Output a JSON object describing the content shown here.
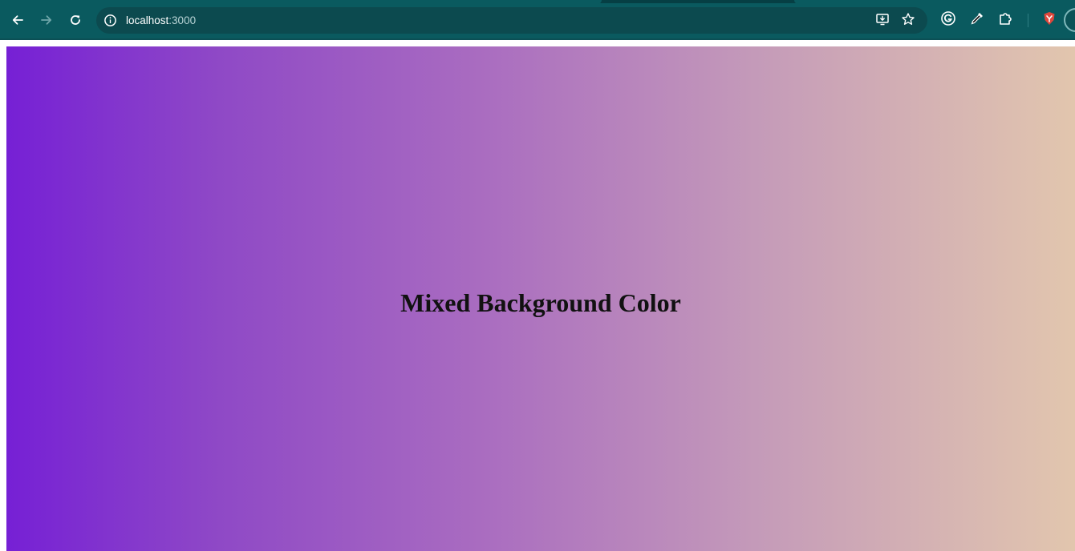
{
  "browser": {
    "address_bar": {
      "host": "localhost",
      "port": ":3000"
    },
    "nav_icons": [
      "back-arrow-icon",
      "forward-arrow-icon",
      "reload-icon"
    ],
    "omnibox_icons": [
      "site-info-icon",
      "install-app-icon",
      "bookmark-star-icon"
    ],
    "extension_icons": [
      "grammarly-icon",
      "eyedropper-icon",
      "extensions-puzzle-icon",
      "brave-shield-icon"
    ],
    "theme_color": "#0a5a5f"
  },
  "page": {
    "heading": "Mixed Background Color",
    "gradient_colors": [
      "#7620d5",
      "#aa6dc0",
      "#e2c6ae"
    ]
  }
}
